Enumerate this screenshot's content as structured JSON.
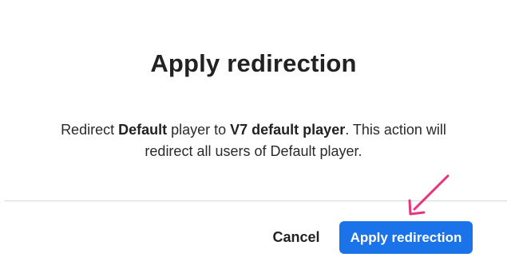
{
  "dialog": {
    "title": "Apply redirection",
    "message": {
      "part1": "Redirect ",
      "source_player": "Default",
      "part2": " player to ",
      "target_player": "V7 default player",
      "part3": ". This action will redirect all users of Default player."
    },
    "buttons": {
      "cancel_label": "Cancel",
      "apply_label": "Apply redirection"
    }
  },
  "colors": {
    "primary_button": "#1a73e8",
    "annotation_arrow": "#e8337f",
    "divider": "#d6d6d6"
  },
  "icons": {
    "annotation": "arrow-pointing-icon"
  }
}
